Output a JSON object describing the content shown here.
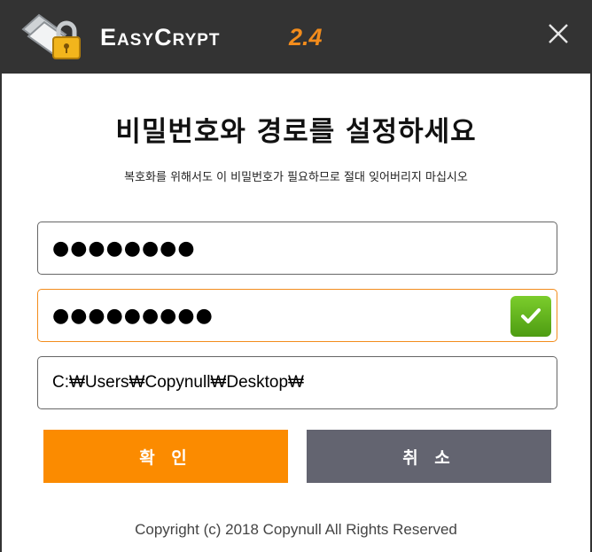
{
  "app": {
    "name": "EasyCrypt",
    "version": "2.4",
    "logo_icon": "folder-lock-icon",
    "close_icon": "close-icon"
  },
  "dialog": {
    "heading": "비밀번호와 경로를 설정하세요",
    "subheading": "복호화를 위해서도 이 비밀번호가 필요하므로 절대 잊어버리지 마십시오"
  },
  "fields": {
    "password": {
      "value": "●●●●●●●●"
    },
    "password_confirm": {
      "value": "●●●●●●●●●",
      "status_icon": "check-icon"
    },
    "path": {
      "value": "C:₩Users₩Copynull₩Desktop₩"
    }
  },
  "buttons": {
    "confirm_label": "확 인",
    "cancel_label": "취 소"
  },
  "footer": {
    "copyright": "Copyright (c) 2018 Copynull All Rights Reserved"
  },
  "colors": {
    "titlebar": "#333333",
    "accent": "#fb8b00",
    "cancel": "#636470",
    "valid": "#5fb31c"
  }
}
